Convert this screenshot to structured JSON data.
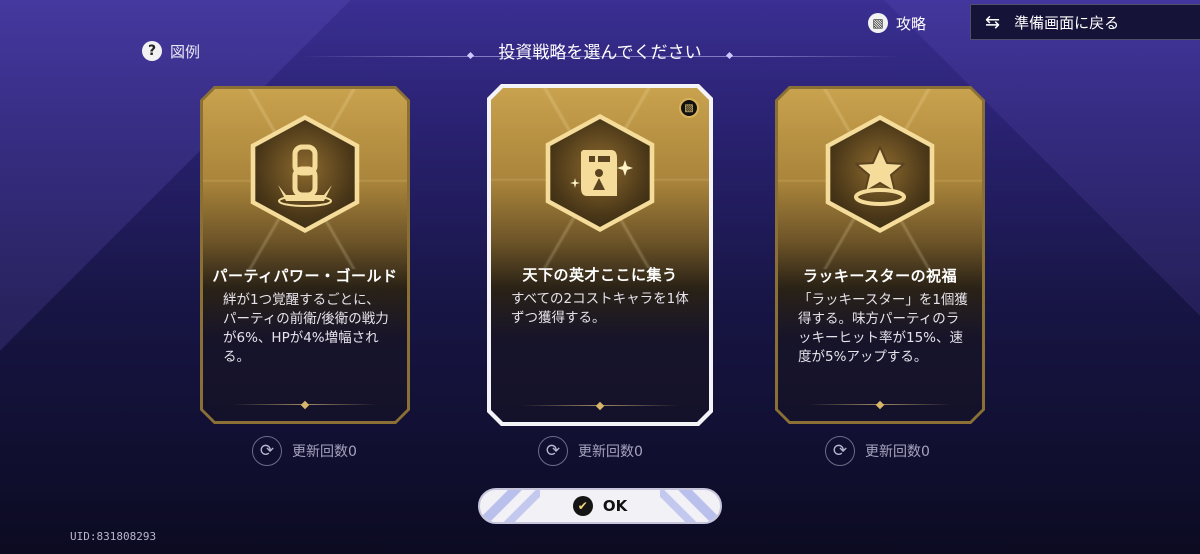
{
  "header": {
    "guide_label": "図例",
    "title": "投資戦略を選んでください",
    "strategy_label": "攻略",
    "back_label": "準備画面に戻る"
  },
  "cards": [
    {
      "title": "パーティパワー・ゴールド",
      "description": "絆が1つ覚醒するごとに、パーティの前衛/後衛の戦力が6%、HPが4%増幅される。",
      "icon": "gold-chain-emblem-icon",
      "selected": false,
      "refresh_label": "更新回数0"
    },
    {
      "title": "天下の英才ここに集う",
      "description": "すべての2コストキャラを1体ずつ獲得する。",
      "icon": "genius-scroll-icon",
      "selected": true,
      "refresh_label": "更新回数0"
    },
    {
      "title": "ラッキースターの祝福",
      "description": "「ラッキースター」を1個獲得する。味方パーティのラッキーヒット率が15%、速度が5%アップする。",
      "icon": "lucky-star-icon",
      "selected": false,
      "refresh_label": "更新回数0"
    }
  ],
  "ok_label": "OK",
  "uid": "UID:831808293",
  "colors": {
    "gold": "#c9a24e",
    "selected_border": "#f4f4f8",
    "background_top": "#3a2f92",
    "background_bottom": "#0c0b22"
  }
}
